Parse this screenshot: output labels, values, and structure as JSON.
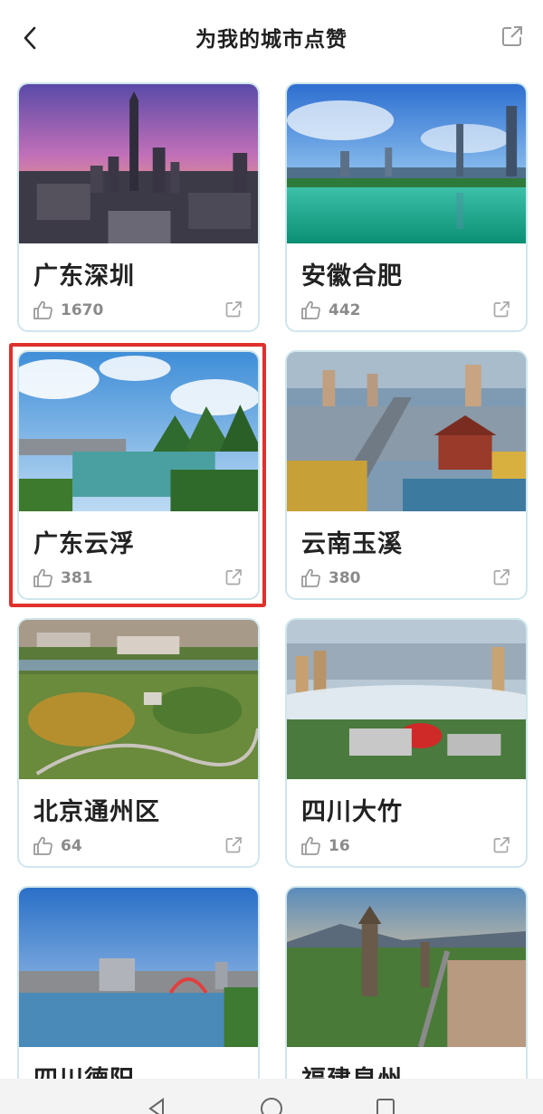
{
  "header": {
    "title": "为我的城市点赞"
  },
  "cards": [
    {
      "city": "广东深圳",
      "likes": "1670"
    },
    {
      "city": "安徽合肥",
      "likes": "442"
    },
    {
      "city": "广东云浮",
      "likes": "381"
    },
    {
      "city": "云南玉溪",
      "likes": "380"
    },
    {
      "city": "北京通州区",
      "likes": "64"
    },
    {
      "city": "四川大竹",
      "likes": "16"
    },
    {
      "city": "四川德阳",
      "likes": ""
    },
    {
      "city": "福建泉州",
      "likes": ""
    }
  ],
  "icons": {
    "back": "back-chevron-icon",
    "share": "share-icon",
    "like": "thumbs-up-icon"
  },
  "colors": {
    "highlight": "#e0302b",
    "card_border": "#cfe6ec"
  }
}
